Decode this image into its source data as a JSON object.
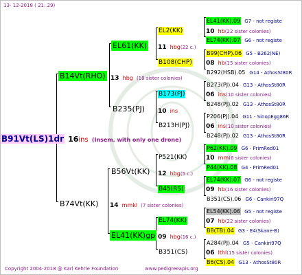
{
  "timestamp": "13- 12-2018 ( 21: 29)",
  "copyright": "Copyright 2004-2018 @ Karl Kehrle Foundation",
  "website": "www.pedigreeapis.org",
  "root": {
    "code": "B91Vt(LS)1dr",
    "num": "16",
    "unit": "ins",
    "note": "(Insem. with only one drone)"
  },
  "sire": {
    "code": "B14Vt(RHO)",
    "num": "13",
    "unit": "hbg",
    "desc": "(18 sister colonies)"
  },
  "dam": {
    "code": "B74Vt(KK)",
    "num": "14",
    "unit": "mmkl",
    "desc": "(7 sister colonies)"
  },
  "gen2": [
    {
      "code": "EL61(KK)",
      "num": "11",
      "unit": "hbg",
      "desc": "(22 c.)",
      "color": "#00ff00"
    },
    {
      "code": "B235(PJ)",
      "num": "10",
      "unit": "ins",
      "desc": "",
      "color": ""
    },
    {
      "code": "B56Vt(KK)",
      "num": "12",
      "unit": "hbg",
      "desc": "(5 c.)",
      "color": ""
    },
    {
      "code": "EL41(KK)gp",
      "num": "09",
      "unit": "hbg",
      "desc": "(16 c.)",
      "color": "#00ff00"
    }
  ],
  "gen3": [
    {
      "code": "EL2(KK)",
      "num": "10",
      "unit": "hb",
      "desc": "(22 sister colonies)",
      "color": "#ffff00"
    },
    {
      "code": "B108(CHP)",
      "num": "08",
      "unit": "hb",
      "desc": "(15 sister colonies)",
      "color": "#ffff00"
    },
    {
      "code": "B173(PJ)",
      "num": "06",
      "unit": "ins",
      "desc": "(10 sister colonies)",
      "color": "#00ffff"
    },
    {
      "code": "B213H(PJ)",
      "num": "06",
      "unit": "ins",
      "desc": "(10 sister colonies)",
      "color": ""
    },
    {
      "code": "P521(KK)",
      "num": "10",
      "unit": "mm",
      "desc": "(6 sister colonies)",
      "color": ""
    },
    {
      "code": "B45(RS)",
      "num": "09",
      "unit": "hb",
      "desc": "(16 sister colonies)",
      "color": "#00ff00"
    },
    {
      "code": "EL74(KK)",
      "num": "07",
      "unit": "hb",
      "desc": "(22 sister colonies)",
      "color": "#00ff00"
    },
    {
      "code": "B351(CS)",
      "num": "06",
      "unit": "lthl",
      "desc": "(15 sister colonies)",
      "color": ""
    }
  ],
  "gen4": [
    {
      "code": "EL41(KK).09",
      "info": "G7 - not registe",
      "color": "#00ff00"
    },
    {
      "code": "EL74(KK).07",
      "info": "G6 - not registe",
      "color": "#00ff00"
    },
    {
      "code": "B99(CHP).06",
      "info": "G5 - B262(NE)",
      "color": "#ffff00"
    },
    {
      "code": "B292(HSB).05",
      "info": "G14 - AthosSt80R",
      "color": ""
    },
    {
      "code": "B273(PJ).04",
      "info": "G13 - AthosSt80R",
      "color": ""
    },
    {
      "code": "B248(PJ).02",
      "info": "G13 - AthosSt80R",
      "color": ""
    },
    {
      "code": "P206(PJ).04",
      "info": "G11 - SinopEgg86R",
      "color": ""
    },
    {
      "code": "B248(PJ).02",
      "info": "G13 - AthosSt80R",
      "color": ""
    },
    {
      "code": "P62(KK).09",
      "info": "G6 - PrimRed01",
      "color": "#00ff00"
    },
    {
      "code": "P44(KK).08",
      "info": "G4 - PrimRed01",
      "color": "#00ff00"
    },
    {
      "code": "EL74(KK).07",
      "info": "G6 - not registe",
      "color": "#00ff00"
    },
    {
      "code": "B351(CS).06",
      "info": "G6 - Cankiri97Q",
      "color": ""
    },
    {
      "code": "EL54(KK).06",
      "info": "G5 - not registe",
      "color": "#c0c0c0"
    },
    {
      "code": "B8(TB).04",
      "info": "G3 - E4(Skane-B)",
      "color": "#ffff00"
    },
    {
      "code": "A284(PJ).04",
      "info": "G5 - Cankiri97Q",
      "color": ""
    },
    {
      "code": "B6(CS).04",
      "info": "G13 - AthosSt80R",
      "color": "#ffff00"
    }
  ]
}
